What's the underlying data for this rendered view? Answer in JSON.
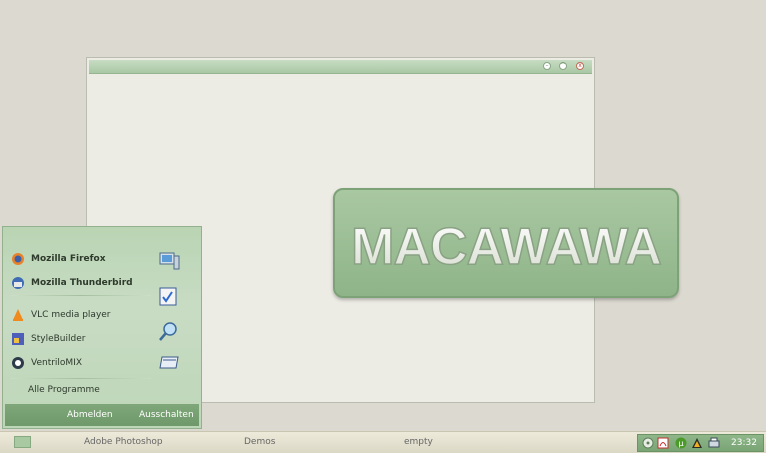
{
  "window": {
    "buttons": [
      "minimize-button",
      "maximize-button",
      "close-button"
    ]
  },
  "logo": {
    "text": "MACAWAWA"
  },
  "start_menu": {
    "items": [
      {
        "label": "Mozilla Firefox",
        "icon": "firefox-icon",
        "bold": true
      },
      {
        "label": "Mozilla Thunderbird",
        "icon": "thunderbird-icon",
        "bold": true
      },
      {
        "label": "VLC media player",
        "icon": "vlc-icon",
        "bold": false
      },
      {
        "label": "StyleBuilder",
        "icon": "stylebuilder-icon",
        "bold": false
      },
      {
        "label": "VentriloMIX",
        "icon": "ventrilo-icon",
        "bold": false
      }
    ],
    "right_icons": [
      "network-computer-icon",
      "checklist-icon",
      "search-magnifier-icon",
      "run-window-icon"
    ],
    "all_programs": "Alle Programme",
    "logoff": "Abmelden",
    "shutdown": "Ausschalten"
  },
  "taskbar": {
    "tasks": [
      "Adobe Photoshop",
      "Demos",
      "empty"
    ],
    "tray_icons": [
      "media-icon",
      "pdf-icon",
      "utorrent-icon",
      "winamp-icon",
      "printer-icon"
    ],
    "clock": "23:32"
  },
  "colors": {
    "accent_green": "#8fb489",
    "desktop": "#dcd9d0",
    "window_body": "#ecebe4"
  }
}
